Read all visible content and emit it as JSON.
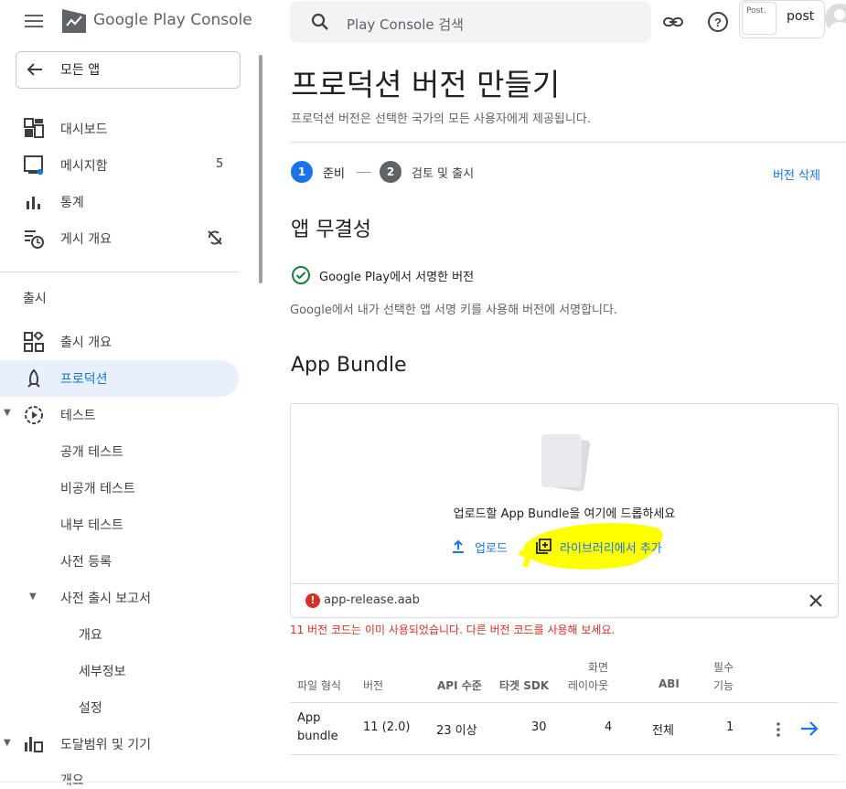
{
  "topbar": {
    "logo_text": "Google Play Console",
    "search_placeholder": "Play Console 검색",
    "post_thumb_text": "Post.",
    "account_label": "post"
  },
  "sidebar": {
    "all_apps": "모든 앱",
    "items": [
      {
        "label": "대시보드",
        "icon": "dashboard-icon"
      },
      {
        "label": "메시지함",
        "icon": "inbox-icon",
        "badge": "5"
      },
      {
        "label": "통계",
        "icon": "bar-chart-icon"
      },
      {
        "label": "게시 개요",
        "icon": "publishing-icon"
      }
    ],
    "section_release": "출시",
    "release_items": [
      {
        "label": "출시 개요",
        "icon": "release-overview-icon"
      },
      {
        "label": "프로덕션",
        "icon": "production-icon",
        "active": true
      },
      {
        "label": "테스트",
        "icon": "testing-icon"
      }
    ],
    "test_sub": [
      "공개 테스트",
      "비공개 테스트",
      "내부 테스트",
      "사전 등록"
    ],
    "pre_launch": "사전 출시 보고서",
    "pre_launch_sub": [
      "개요",
      "세부정보",
      "설정"
    ],
    "reach": "도달범위 및 기기",
    "reach_sub": "개요"
  },
  "main": {
    "title": "프로덕션 버전 만들기",
    "subtitle": "프로덕션 버전은 선택한 국가의 모든 사용자에게 제공됩니다.",
    "step1_num": "1",
    "step1_label": "준비",
    "step2_num": "2",
    "step2_label": "검토 및 출시",
    "delete_version": "버전 삭제",
    "integrity_title": "앱 무결성",
    "signed_label": "Google Play에서 서명한 버전",
    "sign_desc": "Google에서 내가 선택한 앱 서명 키를 사용해 버전에 서명합니다.",
    "bundle_title": "App Bundle",
    "drop_text": "업로드할 App Bundle을 여기에 드롭하세요",
    "upload_link": "업로드",
    "library_link": "라이브러리에서 추가",
    "error_icon_text": "!",
    "file_name": "app-release.aab",
    "error_msg": "11 버전 코드는 이미 사용되었습니다. 다른 버전 코드를 사용해 보세요."
  },
  "table": {
    "headers": [
      "파일 형식",
      "버전",
      "API 수준",
      "타겟 SDK",
      "화면",
      "레이아웃",
      "ABI",
      "필수",
      "기능"
    ],
    "row": {
      "file_type_1": "App",
      "file_type_2": "bundle",
      "version": "11 (2.0)",
      "api": "23 이상",
      "target_sdk": "30",
      "layouts": "4",
      "abi": "전체",
      "features": "1"
    }
  },
  "colors": {
    "accent": "#1a73e8",
    "error": "#d93025",
    "highlight": "#ffff00",
    "active_bg": "#e8f0fe"
  }
}
